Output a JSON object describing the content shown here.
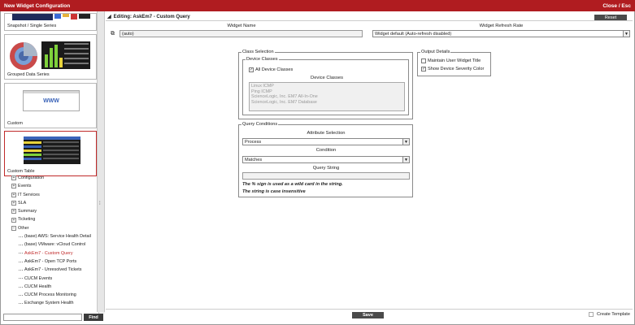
{
  "window": {
    "title": "New Widget Configuration",
    "close_label": "Close / Esc"
  },
  "thumbnails": [
    {
      "caption": "Snapshot / Single Series"
    },
    {
      "caption": "Grouped Data Series"
    },
    {
      "caption": "Custom",
      "preview_text": "WWW"
    },
    {
      "caption": "Custom Table"
    }
  ],
  "tree": {
    "top": [
      "Configuration",
      "Events",
      "IT Services",
      "SLA",
      "Summary",
      "Ticketing"
    ],
    "other_label": "Other",
    "other_children": [
      "(base) AWS: Service Health Detail",
      "(base) VMware: vCloud Control",
      "AskEm7 - Custom Query",
      "AskEm7 - Open TCP Ports",
      "AskEm7 - Unresolved Tickets",
      "CUCM Events",
      "CUCM Health",
      "CUCM Process Monitoring",
      "Exchange System Health"
    ]
  },
  "find": {
    "button_label": "Find",
    "value": ""
  },
  "editor": {
    "heading": "Editing: AskEm7 - Custom Query",
    "reset_label": "Reset",
    "widget_name_label": "Widget Name",
    "widget_name_value": "(auto)",
    "refresh_label": "Widget Refresh Rate",
    "refresh_value": "Widget default (Auto-refresh disabled)"
  },
  "class_selection": {
    "legend": "Class Selection",
    "device_classes_legend": "Device Classes",
    "all_label": "All Device Classes",
    "all_checked": true,
    "list_header": "Device Classes",
    "list_items": [
      "Linux ICMP",
      "Ping ICMP",
      "ScienceLogic, Inc. EM7 All-In-One",
      "ScienceLogic, Inc. EM7 Database"
    ]
  },
  "output_details": {
    "legend": "Output Details",
    "maintain_label": "Maintain User Widget Title",
    "maintain_checked": false,
    "severity_label": "Show Device Severity Color",
    "severity_checked": true
  },
  "query_conditions": {
    "legend": "Query Conditions",
    "attribute_label": "Attribute Selection",
    "attribute_value": "Process",
    "condition_label": "Condition",
    "condition_value": "Matches",
    "query_label": "Query String",
    "query_value": "",
    "note1": "The % sign is used as a wild card in the string.",
    "note2": "The string is case insensitive"
  },
  "footer": {
    "save_label": "Save",
    "create_template_label": "Create Template",
    "create_template_checked": false
  }
}
